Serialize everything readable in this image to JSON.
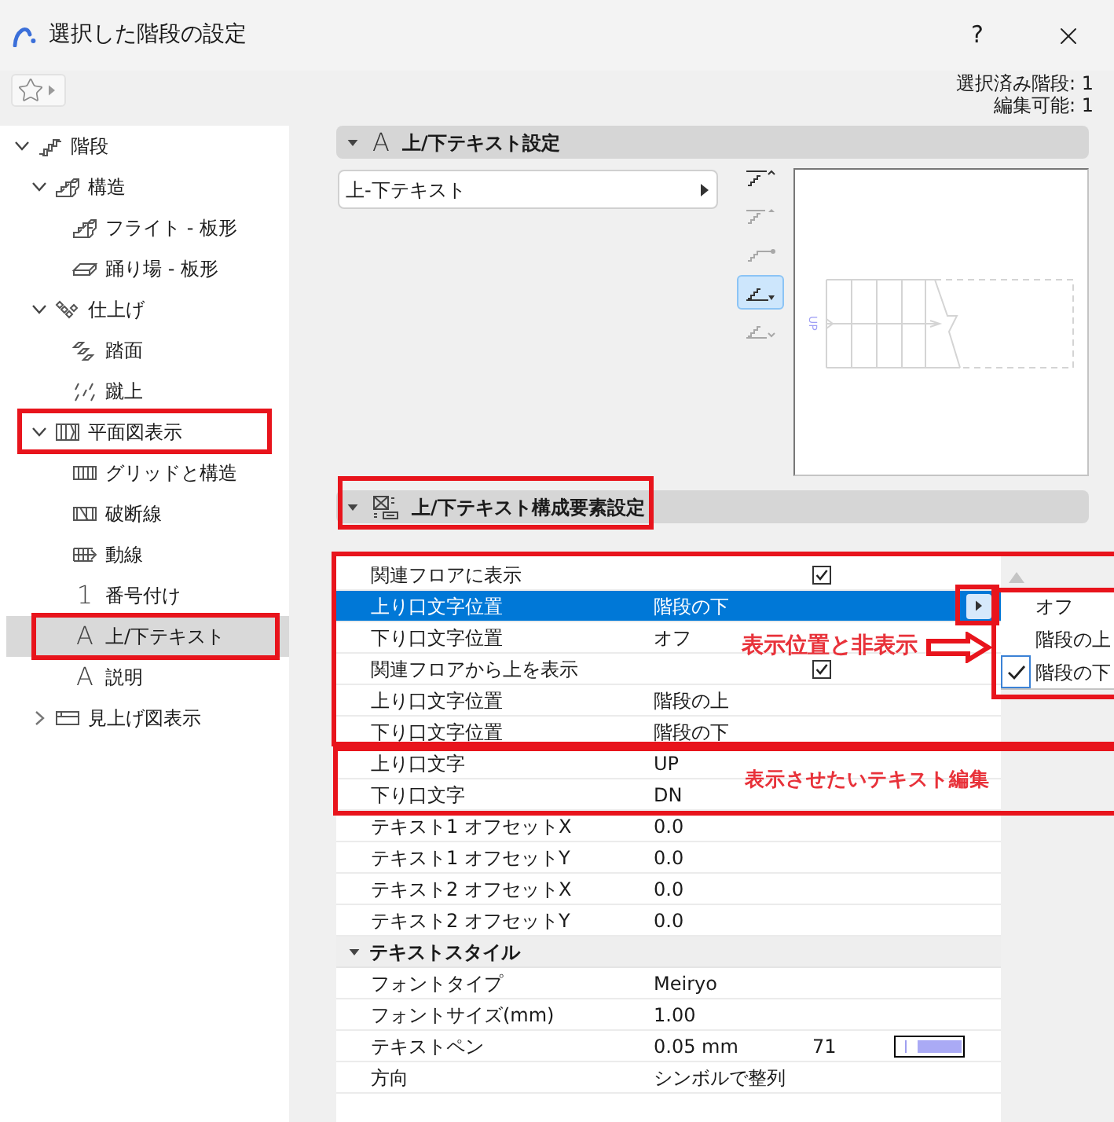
{
  "window": {
    "title": "選択した階段の設定",
    "help": "?"
  },
  "toolbar": {
    "selection_count": "選択済み階段: 1",
    "editable_count": "編集可能: 1"
  },
  "sidebar": {
    "items": [
      {
        "label": "階段",
        "expanded": true,
        "selected": false,
        "children": [
          {
            "label": "構造",
            "expanded": true,
            "selected": false,
            "children": [
              {
                "label": "フライト - 板形",
                "selected": false
              },
              {
                "label": "踊り場 - 板形",
                "selected": false
              }
            ]
          },
          {
            "label": "仕上げ",
            "expanded": true,
            "selected": false,
            "children": [
              {
                "label": "踏面",
                "selected": false
              },
              {
                "label": "蹴上",
                "selected": false
              }
            ]
          },
          {
            "label": "平面図表示",
            "expanded": true,
            "selected": false,
            "children": [
              {
                "label": "グリッドと構造",
                "selected": false
              },
              {
                "label": "破断線",
                "selected": false
              },
              {
                "label": "動線",
                "selected": false
              },
              {
                "label": "番号付け",
                "glyph": "1",
                "selected": false
              },
              {
                "label": "上/下テキスト",
                "glyph": "A",
                "selected": true
              },
              {
                "label": "説明",
                "glyph": "A",
                "selected": false
              }
            ]
          },
          {
            "label": "見上げ図表示",
            "expanded": false,
            "selected": false
          }
        ]
      }
    ]
  },
  "panels": [
    {
      "title": "上/下テキスト設定",
      "glyph": "A",
      "expanded": true
    },
    {
      "title": "上/下テキスト構成要素設定",
      "expanded": true
    }
  ],
  "text_settings": {
    "style": "上-下テキスト",
    "position_options": [
      {
        "selected": false
      },
      {
        "selected": false
      },
      {
        "selected": false
      },
      {
        "selected": true
      },
      {
        "selected": false
      }
    ],
    "preview": {
      "label": "UP"
    }
  },
  "properties": {
    "rows": [
      {
        "kind": "checkbox",
        "label": "関連フロアに表示",
        "checked": true,
        "selected": false
      },
      {
        "kind": "value",
        "label": "上り口文字位置",
        "value": "階段の下",
        "selected": true
      },
      {
        "kind": "value",
        "label": "下り口文字位置",
        "value": "オフ",
        "selected": false
      },
      {
        "kind": "checkbox",
        "label": "関連フロアから上を表示",
        "checked": true,
        "selected": false
      },
      {
        "kind": "value",
        "label": "上り口文字位置",
        "value": "階段の上",
        "selected": false
      },
      {
        "kind": "value",
        "label": "下り口文字位置",
        "value": "階段の下",
        "selected": false
      },
      {
        "kind": "value",
        "label": "上り口文字",
        "value": "UP",
        "selected": false
      },
      {
        "kind": "value",
        "label": "下り口文字",
        "value": "DN",
        "selected": false
      },
      {
        "kind": "value",
        "label": "テキスト1 オフセットX",
        "value": "0.0",
        "selected": false
      },
      {
        "kind": "value",
        "label": "テキスト1 オフセットY",
        "value": "0.0",
        "selected": false
      },
      {
        "kind": "value",
        "label": "テキスト2 オフセットX",
        "value": "0.0",
        "selected": false
      },
      {
        "kind": "value",
        "label": "テキスト2 オフセットY",
        "value": "0.0",
        "selected": false
      },
      {
        "kind": "section",
        "label": "テキストスタイル",
        "expanded": true
      },
      {
        "kind": "value",
        "label": "フォントタイプ",
        "value": "Meiryo",
        "selected": false
      },
      {
        "kind": "value",
        "label": "フォントサイズ(mm)",
        "value": "1.00",
        "selected": false
      },
      {
        "kind": "pen",
        "label": "テキストペン",
        "value": "0.05 mm",
        "pen_number": "71",
        "selected": false
      },
      {
        "kind": "value",
        "label": "方向",
        "value": "シンボルで整列",
        "selected": false
      }
    ]
  },
  "popup_menu": {
    "items": [
      {
        "label": "オフ",
        "checked": false
      },
      {
        "label": "階段の上",
        "checked": false
      },
      {
        "label": "階段の下",
        "checked": true
      }
    ]
  },
  "annotations": [
    {
      "text": "表示位置と非表示"
    },
    {
      "text": "表示させたいテキスト編集"
    }
  ]
}
